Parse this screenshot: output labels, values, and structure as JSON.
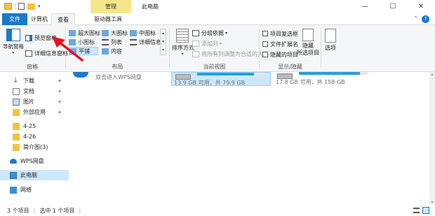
{
  "titlebar": {
    "context_tab": "管理",
    "window_title": "此电脑",
    "buttons": {
      "minimize": "—",
      "maximize": "☐",
      "close": "✕"
    }
  },
  "tabs": [
    {
      "label": "文件"
    },
    {
      "label": "计算机"
    },
    {
      "label": "查看"
    },
    {
      "label": "驱动器工具"
    }
  ],
  "ribbon": {
    "panes": {
      "label": "窗格",
      "nav_pane": "导航窗格",
      "preview_pane": "预览窗格",
      "details_pane": "详细信息窗格"
    },
    "layout": {
      "label": "布局",
      "items": [
        "超大图标",
        "大图标",
        "中图标",
        "小图标",
        "列表",
        "详细信息",
        "平铺",
        "内容"
      ]
    },
    "current_view": {
      "label": "当前视图",
      "sort_by": "排序方式",
      "group_by": "分组依据",
      "add_columns": "添加列",
      "size_all": "将所有列调整为合适的大小"
    },
    "show_hide": {
      "label": "显示/隐藏",
      "item_checkboxes": "项目复选框",
      "file_extensions": "文件扩展名",
      "hidden_items": "隐藏的项目",
      "hide_selected": "隐藏\n所选项目"
    },
    "options": "选项"
  },
  "nav": {
    "items": [
      {
        "label": "下载",
        "pinned": true
      },
      {
        "label": "文档",
        "pinned": true
      },
      {
        "label": "图片",
        "pinned": true
      },
      {
        "label": "外部应用",
        "pinned": true
      },
      {
        "label": "4-25",
        "pinned": false
      },
      {
        "label": "4-26",
        "pinned": false
      },
      {
        "label": "简介图(3)",
        "pinned": false
      },
      {
        "label": "WPS网盘",
        "pinned": false
      },
      {
        "label": "此电脑",
        "pinned": false
      },
      {
        "label": "网络",
        "pinned": false
      }
    ]
  },
  "content": {
    "wps_hint": "双击进入WPS网盘",
    "drives": [
      {
        "free_text": "13.9 GB 可用，共 79.9 GB",
        "used_fraction": 0.83
      },
      {
        "free_text": "17.8 GB 可用，共 158 GB",
        "used_fraction": 0.89
      }
    ]
  },
  "status": {
    "items": "3 个项目",
    "selected": "选中 1 个项目"
  },
  "colors": {
    "accent": "#1979ca",
    "context": "#f6e68a",
    "selection": "#cce8ff",
    "drive_bar": "#26a0da",
    "arrow": "#e81123"
  }
}
